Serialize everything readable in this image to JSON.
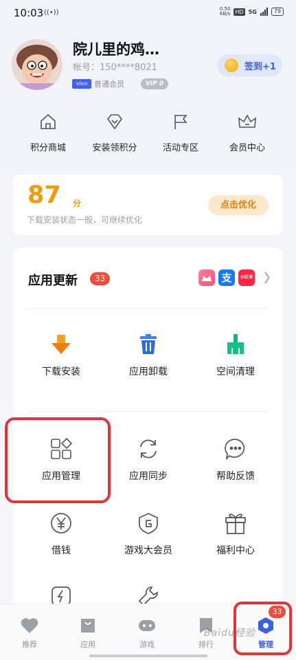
{
  "status_bar": {
    "time": "10:03",
    "hotspot_icon": "((•))",
    "net_speed_value": "0.50",
    "net_speed_unit": "KB/s",
    "hd": "HD",
    "network": "5G",
    "battery": "79"
  },
  "profile": {
    "username": "院儿里的鸡…",
    "account": "帐号：150****8021",
    "brand_badge": "vivo",
    "member_level": "普通会员",
    "vip_level": "VIP 0",
    "checkin_label": "签到+1"
  },
  "quick_menu": [
    {
      "label": "积分商城",
      "icon": "house-icon"
    },
    {
      "label": "安装领积分",
      "icon": "diamond-icon"
    },
    {
      "label": "活动专区",
      "icon": "flag-icon"
    },
    {
      "label": "会员中心",
      "icon": "crown-icon"
    }
  ],
  "score_card": {
    "score": "87",
    "unit": "分",
    "description": "下载安装状态一般，可继续优化",
    "action": "点击优化"
  },
  "updates": {
    "title": "应用更新",
    "count": "33",
    "app_icons": [
      {
        "name": "pinduoduo-app-icon",
        "color": "#f0557a"
      },
      {
        "name": "alipay-app-icon",
        "text": "支",
        "color": "#1677ff"
      },
      {
        "name": "xiaohongshu-app-icon",
        "text": "小红书",
        "color": "#ff2442"
      }
    ]
  },
  "tools": [
    {
      "label": "下载安装",
      "icon": "download-arrow-icon"
    },
    {
      "label": "应用卸载",
      "icon": "trash-icon"
    },
    {
      "label": "空间清理",
      "icon": "broom-icon"
    },
    {
      "label": "应用管理",
      "icon": "app-grid-icon"
    },
    {
      "label": "应用同步",
      "icon": "sync-icon"
    },
    {
      "label": "帮助反馈",
      "icon": "chat-bubble-icon"
    },
    {
      "label": "借钱",
      "icon": "yen-circle-icon"
    },
    {
      "label": "游戏大会员",
      "icon": "game-shield-icon"
    },
    {
      "label": "福利中心",
      "icon": "gift-icon"
    },
    {
      "label": "",
      "icon": "flash-icon"
    },
    {
      "label": "",
      "icon": "wrench-icon"
    }
  ],
  "bottom_nav": [
    {
      "label": "推荐",
      "icon": "heart-icon"
    },
    {
      "label": "应用",
      "icon": "bag-icon"
    },
    {
      "label": "游戏",
      "icon": "gamepad-icon"
    },
    {
      "label": "排行",
      "icon": "bookmark-icon"
    },
    {
      "label": "管理",
      "icon": "manage-hex-icon",
      "active": true,
      "badge": "33"
    }
  ],
  "watermark": "Baidu经验",
  "colors": {
    "accent": "#3a5fe0",
    "score": "#f29a0c",
    "badge": "#f04b3b",
    "highlight": "#e2333c"
  }
}
